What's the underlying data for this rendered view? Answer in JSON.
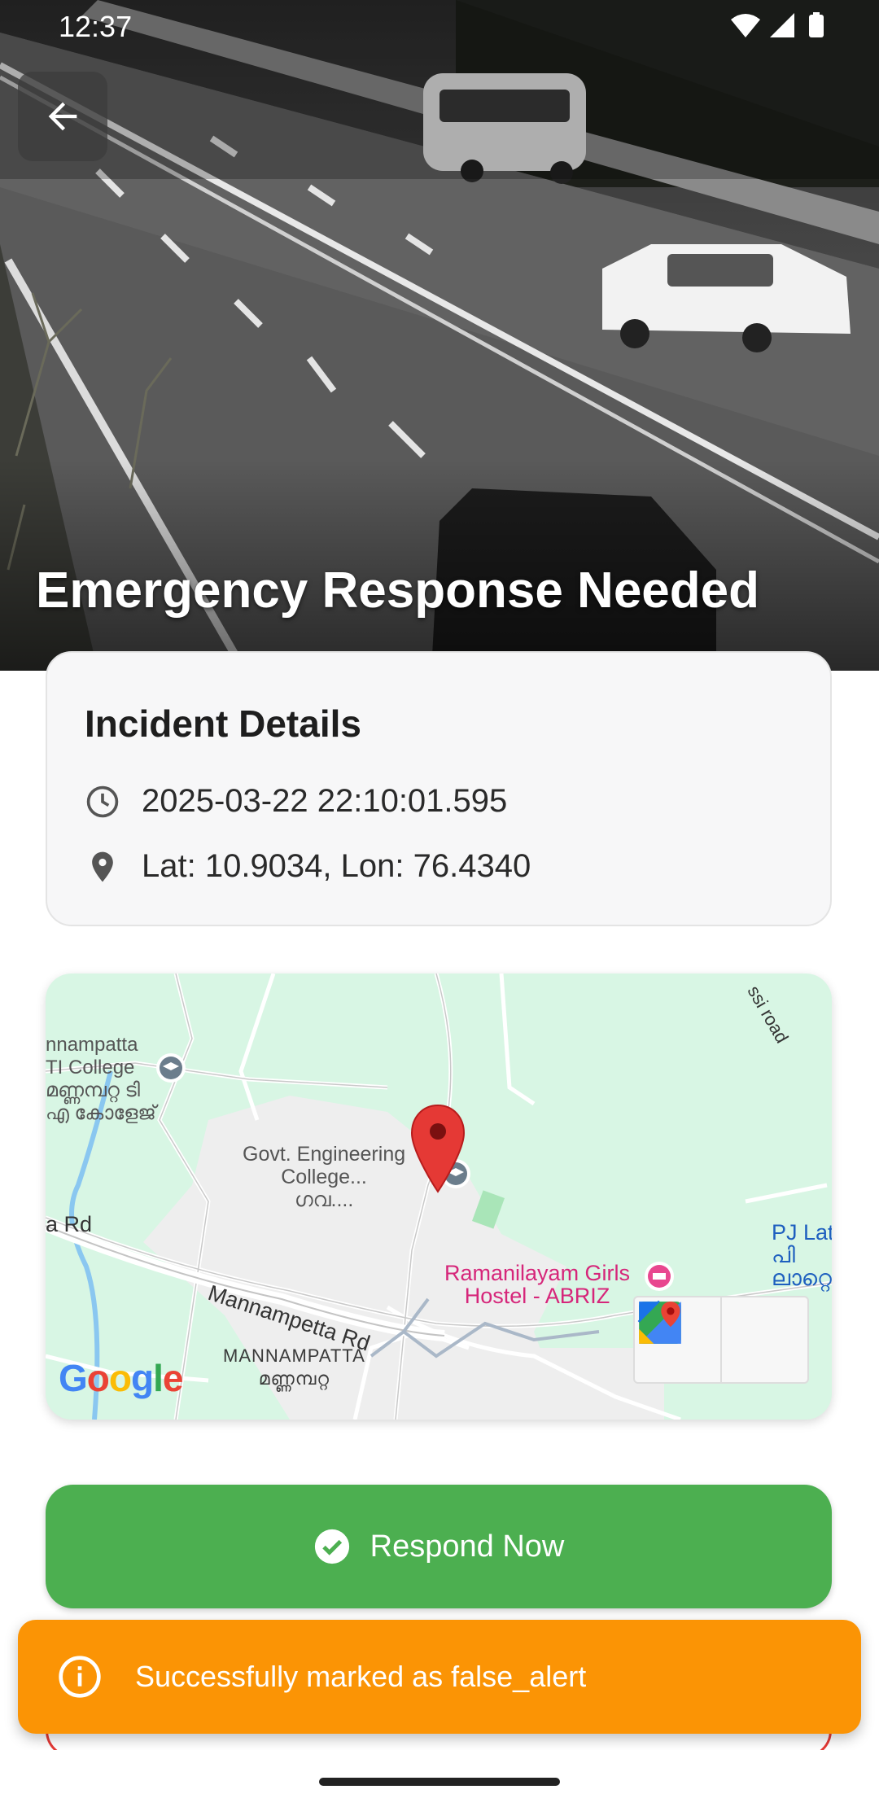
{
  "status_bar": {
    "time": "12:37"
  },
  "hero": {
    "title": "Emergency Response Needed"
  },
  "incident": {
    "title": "Incident Details",
    "timestamp": "2025-03-22 22:10:01.595",
    "location": "Lat: 10.9034, Lon: 76.4340"
  },
  "map": {
    "labels": {
      "tti_college": "nnampatta\nTI College\nമണ്ണമ്പറ്റ ടി\nഎ കോളേജ്",
      "engineering_college": "Govt. Engineering\nCollege...\nഗവ....",
      "hostel": "Ramanilayam Girls\nHostel - ABRIZ",
      "mannampetta_rd": "Mannampetta Rd",
      "rd_left": "a Rd",
      "place": "MANNAMPATTA\nമണ്ണമ്പറ്റ",
      "pj": "PJ Lat\nപി\nലാറ്റെക്",
      "road_top": "ssi road"
    },
    "google": [
      "G",
      "o",
      "o",
      "g",
      "l",
      "e"
    ],
    "google_colors": [
      "#4285F4",
      "#EA4335",
      "#FBBC05",
      "#4285F4",
      "#34A853",
      "#EA4335"
    ],
    "icons": {
      "directions": "directions-icon",
      "google_maps": "google-maps-icon",
      "pin": "map-pin-icon"
    }
  },
  "actions": {
    "respond_label": "Respond Now",
    "respond_color": "#4caf50",
    "secondary_border_color": "#e53935"
  },
  "toast": {
    "message": "Successfully marked as false_alert",
    "color": "#fb9405"
  }
}
